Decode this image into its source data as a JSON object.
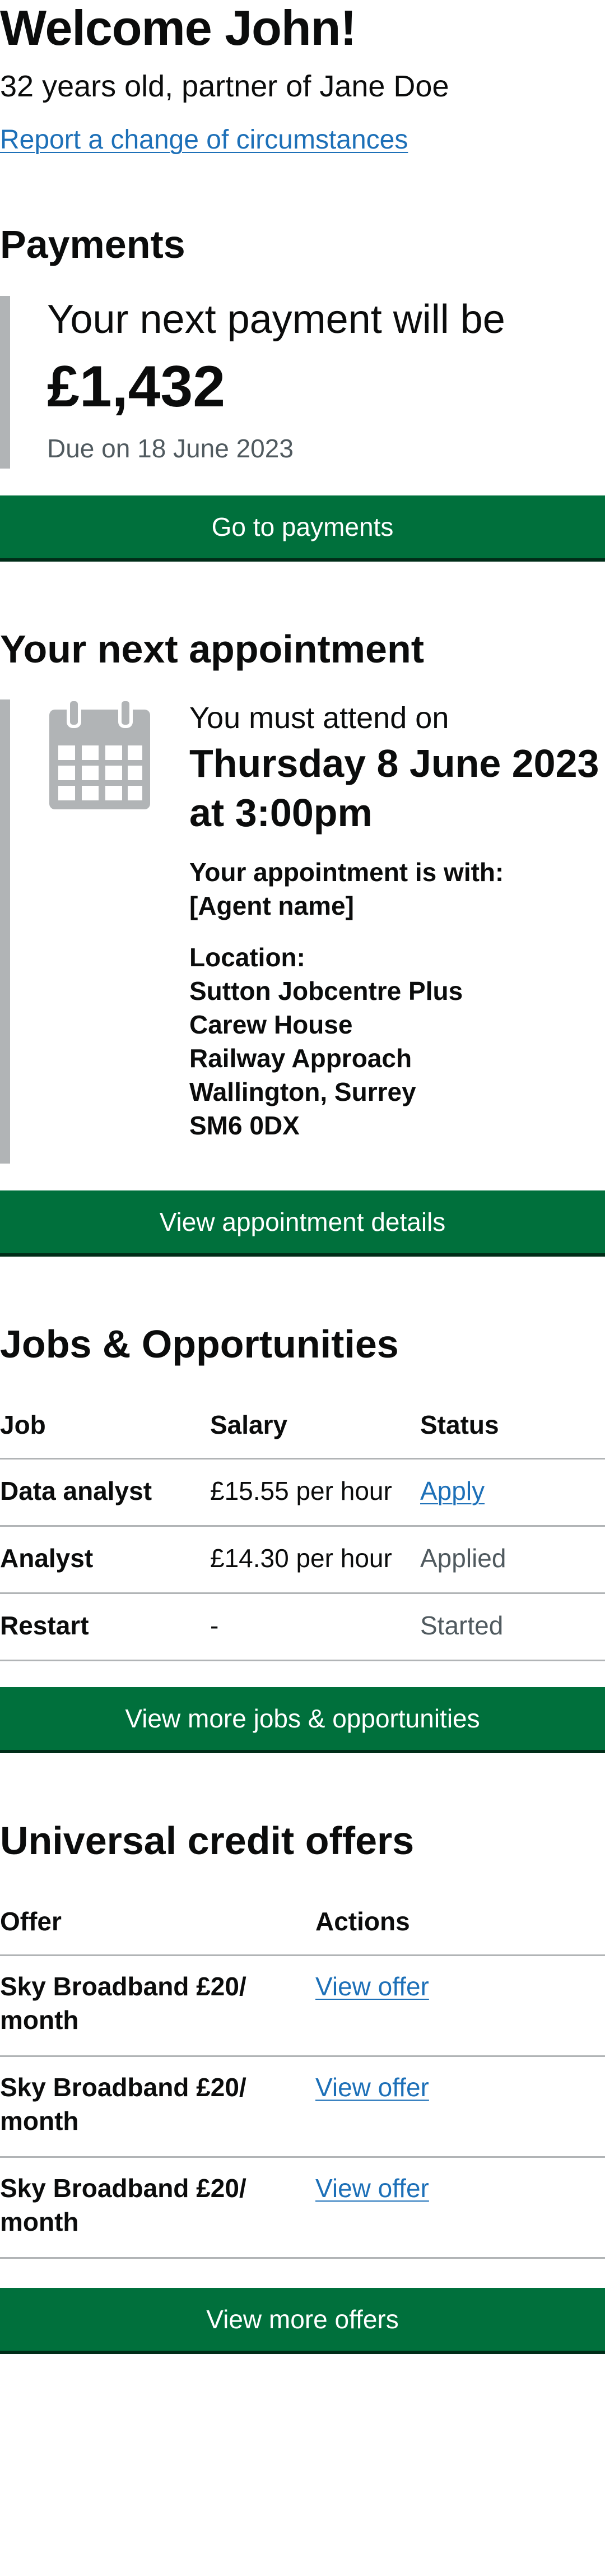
{
  "header": {
    "title": "Welcome John!",
    "subtitle": "32 years old, partner of Jane Doe",
    "report_link": "Report a change of circumstances"
  },
  "payments": {
    "heading": "Payments",
    "lead": "Your next payment will be",
    "amount": "£1,432",
    "due": "Due on 18 June 2023",
    "button": "Go to payments"
  },
  "appointment": {
    "heading": "Your next appointment",
    "lead": "You must attend on",
    "date_line1": "Thursday 8 June 2023",
    "date_line2": "at 3:00pm",
    "with_label": "Your appointment is with:",
    "with_value": "[Agent name]",
    "location_label": "Location:",
    "location_lines": [
      "Sutton Jobcentre Plus",
      "Carew House",
      "Railway Approach",
      "Wallington, Surrey",
      "SM6 0DX"
    ],
    "icon": "calendar-icon",
    "button": "View appointment details"
  },
  "jobs": {
    "heading": "Jobs & Opportunities",
    "columns": [
      "Job",
      "Salary",
      "Status"
    ],
    "rows": [
      {
        "job": "Data analyst",
        "salary": "£15.55 per hour",
        "status": "Apply"
      },
      {
        "job": "Analyst",
        "salary": "£14.30 per hour",
        "status": "Applied"
      },
      {
        "job": "Restart",
        "salary": "-",
        "status": "Started"
      }
    ],
    "button": "View more jobs & opportunities"
  },
  "offers": {
    "heading": "Universal credit offers",
    "columns": [
      "Offer",
      "Actions"
    ],
    "rows": [
      {
        "offer_line1": "Sky Broadband £20/",
        "offer_line2": "month",
        "action": "View offer"
      },
      {
        "offer_line1": "Sky Broadband £20/",
        "offer_line2": "month",
        "action": "View offer"
      },
      {
        "offer_line1": "Sky Broadband £20/",
        "offer_line2": "month",
        "action": "View offer"
      }
    ],
    "button": "View more offers"
  },
  "colors": {
    "button_green": "#00703c",
    "link_blue": "#1d70b8",
    "border_grey": "#b1b4b6",
    "secondary_text": "#505a5f"
  }
}
